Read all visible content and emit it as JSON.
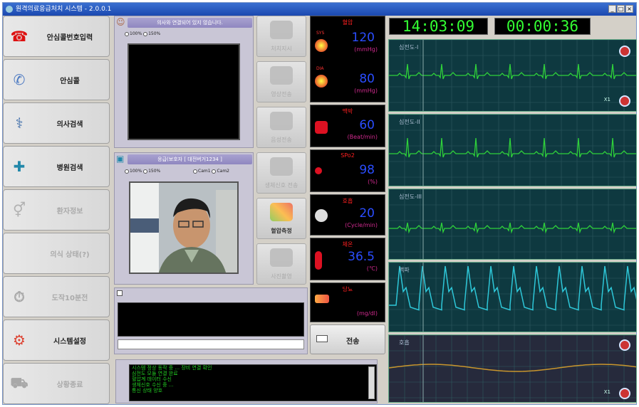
{
  "window": {
    "title": "원격의료응급처치 시스템 - 2.0.0.1",
    "buttons": [
      "_",
      "□",
      "×"
    ]
  },
  "sidebar": [
    {
      "label": "안심콜번호입력",
      "icon": "phone-red-icon",
      "enabled": true
    },
    {
      "label": "안심콜",
      "icon": "telephone-handset-icon",
      "enabled": true
    },
    {
      "label": "의사검색",
      "icon": "doctor-icon",
      "enabled": true
    },
    {
      "label": "병원검색",
      "icon": "hospital-building-icon",
      "enabled": true
    },
    {
      "label": "환자정보",
      "icon": "gender-symbol-icon",
      "enabled": false
    },
    {
      "label": "의식 상태(?)",
      "icon": "blank-icon",
      "enabled": false
    },
    {
      "label": "도작10분전",
      "icon": "timer-icon",
      "enabled": false
    },
    {
      "label": "시스템설정",
      "icon": "gears-icon",
      "enabled": true
    },
    {
      "label": "상황종료",
      "icon": "ambulance-icon",
      "enabled": false
    }
  ],
  "doctor_panel": {
    "header": "의사와 연결되어 있지 않습니다.",
    "zoom_options": [
      "100%",
      "150%"
    ]
  },
  "patient_panel": {
    "header": "응급(보호자 [ 대전버거1234 ]",
    "zoom_options": [
      "100%",
      "150%"
    ],
    "cam_options": [
      "Cam1",
      "Cam2"
    ]
  },
  "tools": [
    {
      "label": "처치지시",
      "enabled": false
    },
    {
      "label": "영상전송",
      "enabled": false
    },
    {
      "label": "음성전송",
      "enabled": false
    },
    {
      "label": "생체신호 전송",
      "enabled": false
    },
    {
      "label": "혈압측정",
      "enabled": true
    },
    {
      "label": "사진촬영",
      "enabled": false
    }
  ],
  "vitals": {
    "bp": {
      "name": "혈압",
      "sys_label": "SYS",
      "sys_value": "120",
      "sys_unit": "(mmHg)",
      "dia_label": "DIA",
      "dia_value": "80",
      "dia_unit": "(mmHg)"
    },
    "pulse": {
      "name": "맥박",
      "value": "60",
      "unit": "(Beat/min)"
    },
    "spo2": {
      "name": "SPo2",
      "value": "98",
      "unit": "(%)"
    },
    "resp": {
      "name": "호흡",
      "value": "20",
      "unit": "(Cycle/min)"
    },
    "temp": {
      "name": "체온",
      "value": "36.5",
      "unit": "(℃)"
    },
    "glucose": {
      "name": "당뇨",
      "value": "",
      "unit": "(mg/dl)"
    }
  },
  "send_button": {
    "label": "전송"
  },
  "clocks": {
    "time": "14:03:09",
    "elapsed": "00:00:36"
  },
  "ecg_channels": [
    {
      "label": "심전도-I",
      "scale": "X1"
    },
    {
      "label": "심전도-II",
      "scale": ""
    },
    {
      "label": "심전도-III",
      "scale": ""
    },
    {
      "label": "맥파",
      "scale": ""
    },
    {
      "label": "호흡",
      "scale": "X1"
    }
  ],
  "messages": [
    "시스템 정상 동작 중 ... 장비 연결 확인",
    "심전도 모듈 연결 완료",
    "혈압계 데이터 수신",
    "생체신호 수신 중 ...",
    "통신 상태 양호"
  ],
  "colors": {
    "vital_value": "#2a4dff",
    "vital_name": "#ff2020",
    "unit": "#d02a8e",
    "clock": "#33ff33",
    "ecg_trace": "#2fd13a",
    "pleth_trace": "#2ec7d8",
    "resp_trace": "#c9962d"
  }
}
